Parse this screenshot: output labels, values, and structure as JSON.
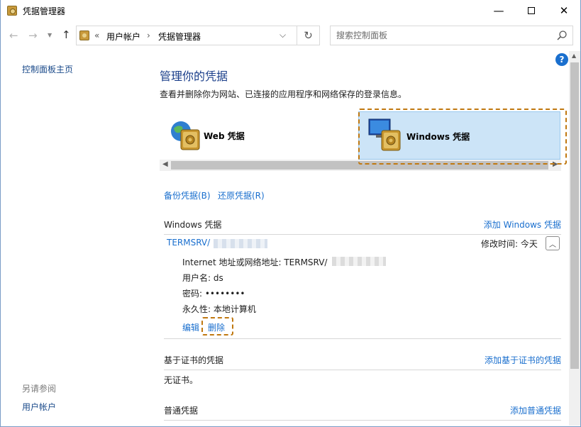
{
  "window": {
    "title": "凭据管理器",
    "minimize": "—",
    "close": "✕"
  },
  "nav": {
    "back": "←",
    "forward": "→",
    "up": "↑",
    "breadcrumb_prefix": "«",
    "crumb1": "用户帐户",
    "separator": "›",
    "crumb2": "凭据管理器",
    "dropdown": "⌵",
    "refresh": "↻",
    "search_placeholder": "搜索控制面板"
  },
  "left": {
    "home": "控制面板主页",
    "see_also": "另请参阅",
    "user_accounts": "用户帐户"
  },
  "main": {
    "title": "管理你的凭据",
    "description": "查看并删除你为网站、已连接的应用程序和网络保存的登录信息。",
    "web_tile": "Web 凭据",
    "windows_tile": "Windows 凭据",
    "backup": "备份凭据(B)",
    "restore": "还原凭据(R)",
    "help": "?"
  },
  "windows_credentials": {
    "header": "Windows 凭据",
    "add": "添加 Windows 凭据",
    "entry": {
      "name": "TERMSRV/",
      "modified": "修改时间:  今天",
      "collapse": "︿",
      "address_label": "Internet 地址或网络地址:  TERMSRV/",
      "username": "用户名:  ds",
      "password": "密码:  ••••••••",
      "persistence": "永久性:  本地计算机",
      "edit": "编辑",
      "delete": "删除"
    }
  },
  "cert_credentials": {
    "header": "基于证书的凭据",
    "add": "添加基于证书的凭据",
    "empty": "无证书。"
  },
  "generic_credentials": {
    "header": "普通凭据",
    "add": "添加普通凭据"
  },
  "colors": {
    "link": "#1a6fce",
    "title": "#1a3e8a",
    "selected_tile": "#cce4f7",
    "highlight": "#c07810"
  }
}
